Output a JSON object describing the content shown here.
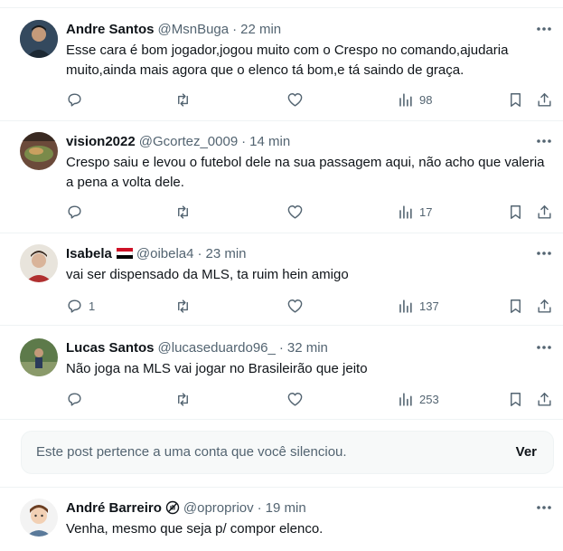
{
  "tweets": [
    {
      "name": "Andre Santos",
      "handle": "@MsnBuga",
      "dot": "·",
      "time": "22 min",
      "text": "Esse cara é bom jogador,jogou muito com o Crespo no comando,ajudaria muito,ainda mais agora que o elenco tá bom,e tá saindo de graça.",
      "replies": "",
      "views": "98"
    },
    {
      "name": "vision2022",
      "handle": "@Gcortez_0009",
      "dot": "·",
      "time": "14 min",
      "text": "Crespo saiu e levou o futebol dele na sua passagem aqui, não acho que valeria a pena a volta dele.",
      "replies": "",
      "views": "17"
    },
    {
      "name": "Isabela",
      "handle": "@oibela4",
      "dot": "·",
      "time": "23 min",
      "text": "vai ser dispensado da MLS, ta ruim hein amigo",
      "replies": "1",
      "views": "137"
    },
    {
      "name": "Lucas Santos",
      "handle": "@lucaseduardo96_",
      "dot": "·",
      "time": "32 min",
      "text": "Não joga na MLS vai jogar no Brasileirão que jeito",
      "replies": "",
      "views": "253"
    }
  ],
  "muted": {
    "text": "Este post pertence a uma conta que você silenciou.",
    "button": "Ver"
  },
  "last_tweet": {
    "name": "André Barreiro",
    "handle": "@opropriov",
    "dot": "·",
    "time": "19 min",
    "text": "Venha, mesmo que seja p/ compor elenco."
  },
  "icons": {
    "more": "more-horizontal-icon",
    "reply": "reply-icon",
    "retweet": "retweet-icon",
    "like": "heart-icon",
    "views": "views-chart-icon",
    "bookmark": "bookmark-icon",
    "share": "share-icon"
  },
  "colors": {
    "text_primary": "#0f1419",
    "text_secondary": "#536471",
    "divider": "#eff3f4",
    "muted_bg": "#f7f9f9"
  }
}
